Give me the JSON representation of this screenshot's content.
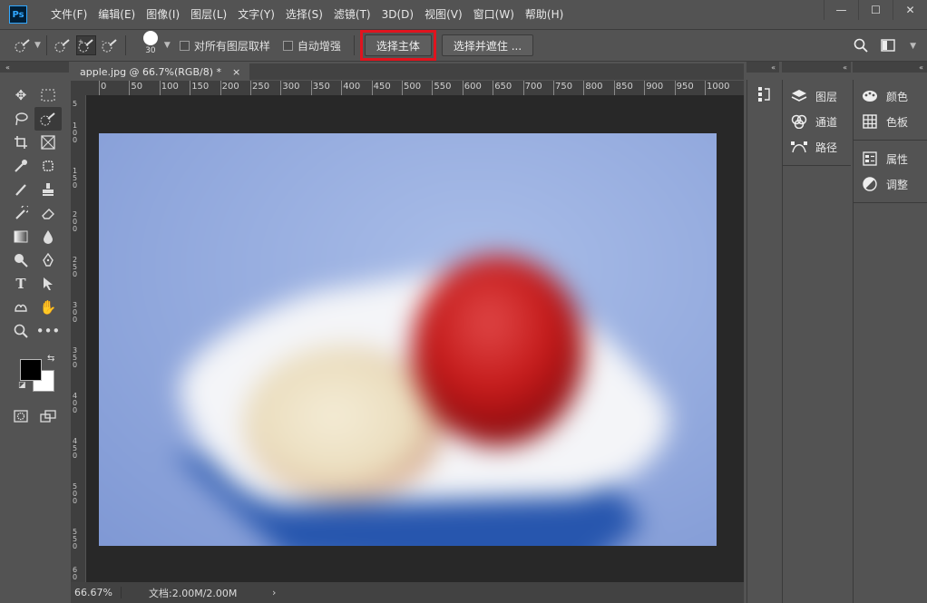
{
  "app": {
    "logo": "Ps"
  },
  "menu": [
    "文件(F)",
    "编辑(E)",
    "图像(I)",
    "图层(L)",
    "文字(Y)",
    "选择(S)",
    "滤镜(T)",
    "3D(D)",
    "视图(V)",
    "窗口(W)",
    "帮助(H)"
  ],
  "window_controls": {
    "minimize": "—",
    "maximize": "☐",
    "close": "✕"
  },
  "options": {
    "brush_size": "30",
    "sample_all_layers": "对所有图层取样",
    "auto_enhance": "自动增强",
    "select_subject": "选择主体",
    "select_and_mask": "选择并遮住 ..."
  },
  "document": {
    "tab_title": "apple.jpg @ 66.7%(RGB/8) *",
    "tab_close": "×",
    "zoom": "66.67%",
    "doc_size": "文档:2.00M/2.00M",
    "status_arrow": "›"
  },
  "ruler_top": [
    "0",
    "50",
    "100",
    "150",
    "200",
    "250",
    "300",
    "350",
    "400",
    "450",
    "500",
    "550",
    "600",
    "650",
    "700",
    "750",
    "800",
    "850",
    "900",
    "950",
    "1000"
  ],
  "panels": {
    "col1": [
      {
        "icon": "layers-icon",
        "label": "图层"
      },
      {
        "icon": "channels-icon",
        "label": "通道"
      },
      {
        "icon": "paths-icon",
        "label": "路径"
      }
    ],
    "col2_group1": [
      {
        "icon": "color-icon",
        "label": "颜色"
      },
      {
        "icon": "swatches-icon",
        "label": "色板"
      }
    ],
    "col2_group2": [
      {
        "icon": "properties-icon",
        "label": "属性"
      },
      {
        "icon": "adjustments-icon",
        "label": "调整"
      }
    ]
  },
  "colors": {
    "foreground": "#000000",
    "background": "#ffffff",
    "highlight": "#e0141e",
    "ui_bg": "#535353",
    "canvas_bg": "#282828"
  }
}
